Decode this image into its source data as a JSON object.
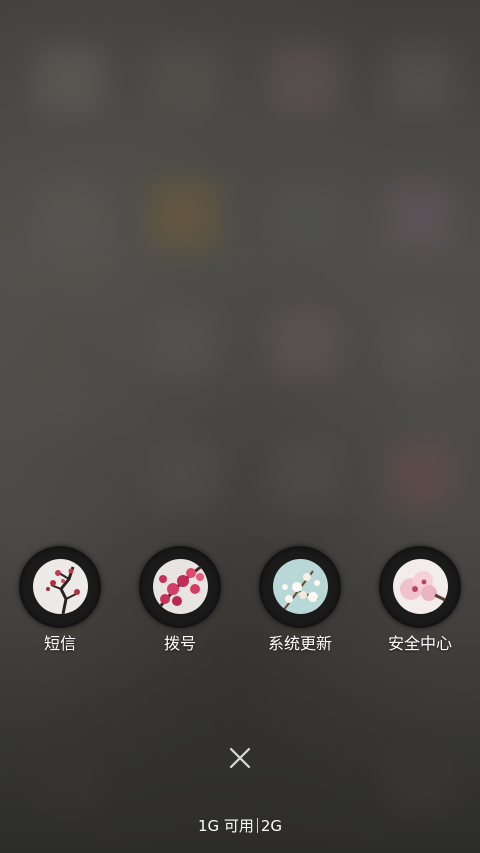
{
  "recents": {
    "apps": [
      {
        "label": "短信",
        "icon": "plum-blossom-thumbnail-icon"
      },
      {
        "label": "拨号",
        "icon": "pink-blossom-thumbnail-icon"
      },
      {
        "label": "系统更新",
        "icon": "white-blossom-thumbnail-icon"
      },
      {
        "label": "安全中心",
        "icon": "cherry-blossom-thumbnail-icon"
      }
    ],
    "close_icon": "close-icon",
    "memory": {
      "free": "1G 可用",
      "total": "2G"
    }
  },
  "colors": {
    "label_text": "#ffffff",
    "background": "#4a4945"
  }
}
